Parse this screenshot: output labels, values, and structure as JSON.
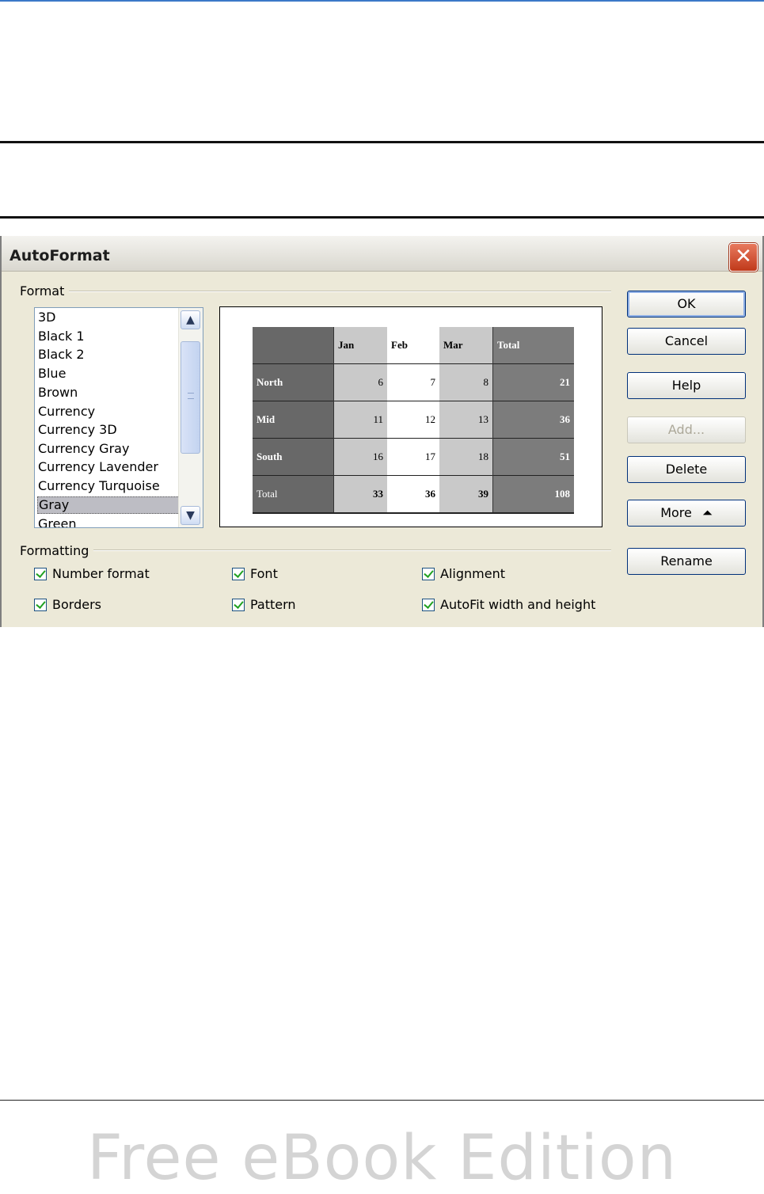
{
  "dialog": {
    "title": "AutoFormat",
    "close_glyph": "✕",
    "format_group": "Format",
    "formatting_group": "Formatting",
    "format_list": [
      "3D",
      "Black 1",
      "Black 2",
      "Blue",
      "Brown",
      "Currency",
      "Currency 3D",
      "Currency Gray",
      "Currency Lavender",
      "Currency Turquoise",
      "Gray",
      "Green"
    ],
    "selected_format": "Gray",
    "buttons": {
      "ok": "OK",
      "cancel": "Cancel",
      "help": "Help",
      "add": "Add...",
      "delete": "Delete",
      "more": "More",
      "more_glyph": "⏶",
      "rename": "Rename"
    },
    "options": {
      "number_format": "Number format",
      "font": "Font",
      "alignment": "Alignment",
      "borders": "Borders",
      "pattern": "Pattern",
      "autofit": "AutoFit width and height"
    }
  },
  "preview": {
    "header": [
      "",
      "Jan",
      "Feb",
      "Mar",
      "Total"
    ],
    "rows": [
      [
        "North",
        "6",
        "7",
        "8",
        "21"
      ],
      [
        "Mid",
        "11",
        "12",
        "13",
        "36"
      ],
      [
        "South",
        "16",
        "17",
        "18",
        "51"
      ],
      [
        "Total",
        "33",
        "36",
        "39",
        "108"
      ]
    ]
  },
  "footer": {
    "watermark": "Free eBook Edition"
  },
  "colors": {
    "dialog_bg": "#ece9d8",
    "accent_rule": "#3b78c8",
    "close_button": "#c0391a"
  }
}
